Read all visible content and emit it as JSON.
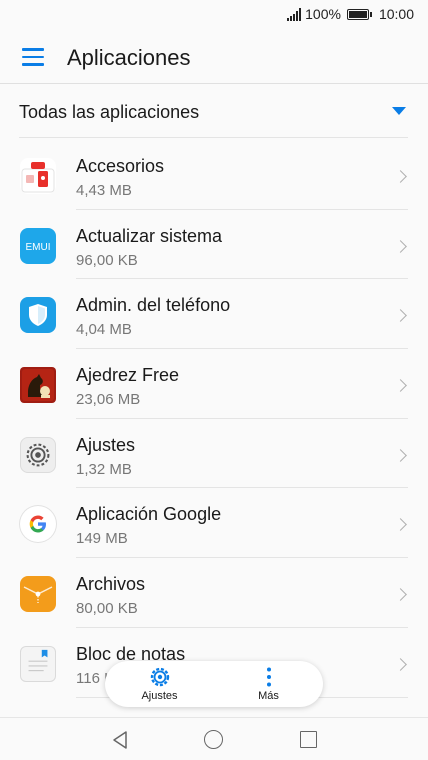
{
  "status_bar": {
    "battery_percent": "100%",
    "time": "10:00"
  },
  "header": {
    "title": "Aplicaciones",
    "menu_icon": "hamburger-menu-icon"
  },
  "filter": {
    "label": "Todas las aplicaciones",
    "icon": "dropdown-caret-icon"
  },
  "apps": [
    {
      "name": "Accesorios",
      "size": "4,43 MB",
      "icon": "accessories-icon"
    },
    {
      "name": "Actualizar sistema",
      "size": "96,00 KB",
      "icon": "emui-update-icon"
    },
    {
      "name": "Admin. del teléfono",
      "size": "4,04 MB",
      "icon": "phone-manager-shield-icon"
    },
    {
      "name": "Ajedrez Free",
      "size": "23,06 MB",
      "icon": "chess-icon"
    },
    {
      "name": "Ajustes",
      "size": "1,32 MB",
      "icon": "settings-gear-icon"
    },
    {
      "name": "Aplicación Google",
      "size": "149 MB",
      "icon": "google-icon"
    },
    {
      "name": "Archivos",
      "size": "80,00 KB",
      "icon": "files-folder-icon"
    },
    {
      "name": "Bloc de notas",
      "size": "116 KB",
      "icon": "notepad-icon"
    }
  ],
  "floating_toolbar": {
    "settings_label": "Ajustes",
    "more_label": "Más"
  },
  "colors": {
    "accent": "#0a7de6",
    "background": "#fafafa"
  }
}
